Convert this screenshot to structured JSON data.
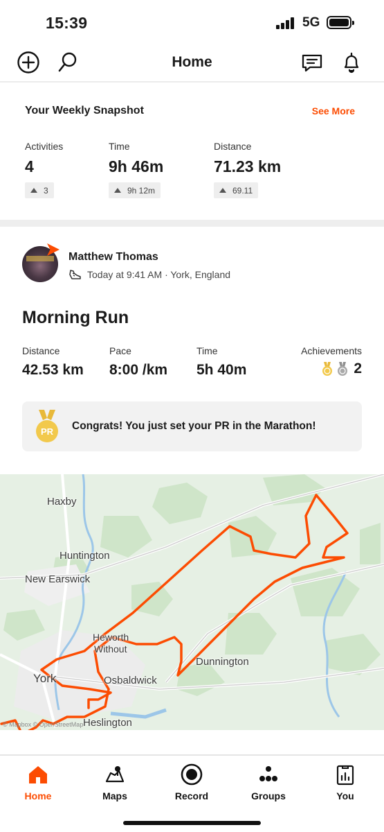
{
  "status_bar": {
    "time": "15:39",
    "network": "5G"
  },
  "header": {
    "title": "Home",
    "icons": [
      "add-icon",
      "search-icon",
      "chat-icon",
      "bell-icon"
    ]
  },
  "weekly_snapshot": {
    "title": "Your Weekly Snapshot",
    "see_more": "See More",
    "stats": [
      {
        "label": "Activities",
        "value": "4",
        "delta": "3"
      },
      {
        "label": "Time",
        "value": "9h 46m",
        "delta": "9h 12m"
      },
      {
        "label": "Distance",
        "value": "71.23 km",
        "delta": "69.11"
      }
    ]
  },
  "activity": {
    "athlete": "Matthew Thomas",
    "meta": "Today at 9:41 AM · York, England",
    "title": "Morning Run",
    "stats": [
      {
        "label": "Distance",
        "value": "42.53 km"
      },
      {
        "label": "Pace",
        "value": "8:00 /km"
      },
      {
        "label": "Time",
        "value": "5h 40m"
      }
    ],
    "achievements": {
      "label": "Achievements",
      "count": "2"
    },
    "congrats": {
      "medal_text": "PR",
      "text": "Congrats! You just set your PR in the Marathon!"
    },
    "map": {
      "labels": {
        "haxby": "Haxby",
        "huntington": "Huntington",
        "new_earswick": "New Earswick",
        "heworth": "Heworth",
        "without": "Without",
        "york": "York",
        "osbaldwick": "Osbaldwick",
        "dunnington": "Dunnington",
        "heslington": "Heslington"
      },
      "attribution": "© Mapbox © OpenStreetMap",
      "route_color": "#fc4c02"
    }
  },
  "bottom_nav": {
    "items": [
      {
        "label": "Home",
        "icon": "home-icon",
        "active": true
      },
      {
        "label": "Maps",
        "icon": "map-icon",
        "active": false
      },
      {
        "label": "Record",
        "icon": "record-icon",
        "active": false
      },
      {
        "label": "Groups",
        "icon": "groups-icon",
        "active": false
      },
      {
        "label": "You",
        "icon": "profile-icon",
        "active": false
      }
    ]
  },
  "colors": {
    "accent": "#fc4c02",
    "gold": "#f2c94c",
    "silver": "#a9a9a9"
  }
}
